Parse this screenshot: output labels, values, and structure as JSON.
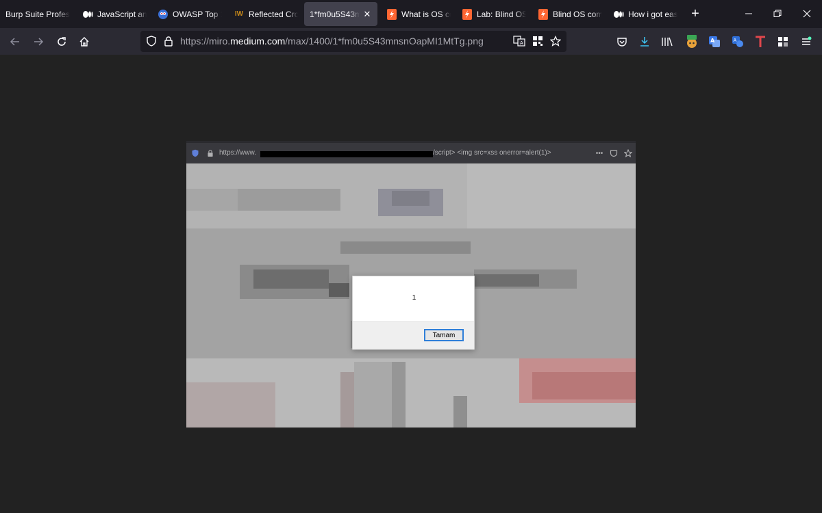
{
  "tabs": [
    {
      "label": "Burp Suite Profess",
      "icon": "burp-icon",
      "active": false
    },
    {
      "label": "JavaScript ana",
      "icon": "medium-icon",
      "active": false
    },
    {
      "label": "OWASP Top 1",
      "icon": "owasp-icon",
      "active": false
    },
    {
      "label": "Reflected Cro",
      "icon": "iw-icon",
      "icon_text": "IW",
      "active": false
    },
    {
      "label": "1*fm0u5S43mn",
      "icon": "",
      "active": true
    },
    {
      "label": "What is OS co",
      "icon": "portswigger-icon",
      "active": false
    },
    {
      "label": "Lab: Blind OS",
      "icon": "portswigger-icon",
      "active": false
    },
    {
      "label": "Blind OS comm",
      "icon": "portswigger-icon",
      "active": false
    },
    {
      "label": "How i got eas",
      "icon": "medium-icon",
      "active": false
    }
  ],
  "url": {
    "prefix": "https://miro.",
    "domain": "medium.com",
    "path": "/max/1400/1*fm0u5S43mnsnOapMI1MtTg.png"
  },
  "screenshot": {
    "url_start": "https://www.",
    "url_end": "/script> <img src=xss onerror=alert(1)>",
    "dialog_message": "1",
    "dialog_button": "Tamam"
  },
  "colors": {
    "tab_bg": "#1c1b22",
    "active_tab": "#42414d",
    "navbar": "#2b2a33",
    "urlbar": "#1c1b22",
    "viewer_bg": "#222222",
    "accent_blue": "#2f7fd9",
    "portswigger_orange": "#ff6633"
  }
}
